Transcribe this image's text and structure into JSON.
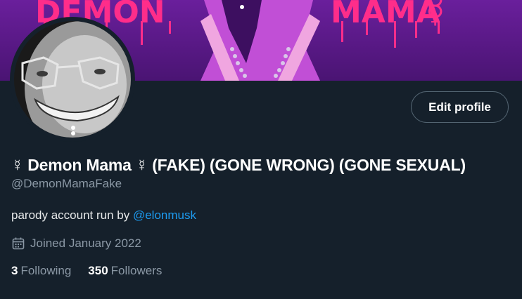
{
  "banner": {
    "text_left": "DEMON",
    "text_right": "MAMA",
    "symbol": "☿",
    "colors": {
      "background": "#5b1a8a",
      "text": "#ff2d8a"
    }
  },
  "avatar": {
    "description_icon": "avatar-photo"
  },
  "profile": {
    "edit_button_label": "Edit profile",
    "display_name": "☿ Demon Mama ☿ (FAKE) (GONE WRONG) (GONE SEXUAL)",
    "handle": "@DemonMamaFake",
    "bio_prefix": "parody account run by ",
    "bio_mention": "@elonmusk",
    "joined_icon": "calendar-icon",
    "joined_text": "Joined January 2022"
  },
  "stats": {
    "following_count": "3",
    "following_label": "Following",
    "followers_count": "350",
    "followers_label": "Followers"
  },
  "colors": {
    "background": "#15202b",
    "secondary_text": "#8b98a5",
    "link": "#1d9bf0",
    "button_border": "#536471"
  }
}
